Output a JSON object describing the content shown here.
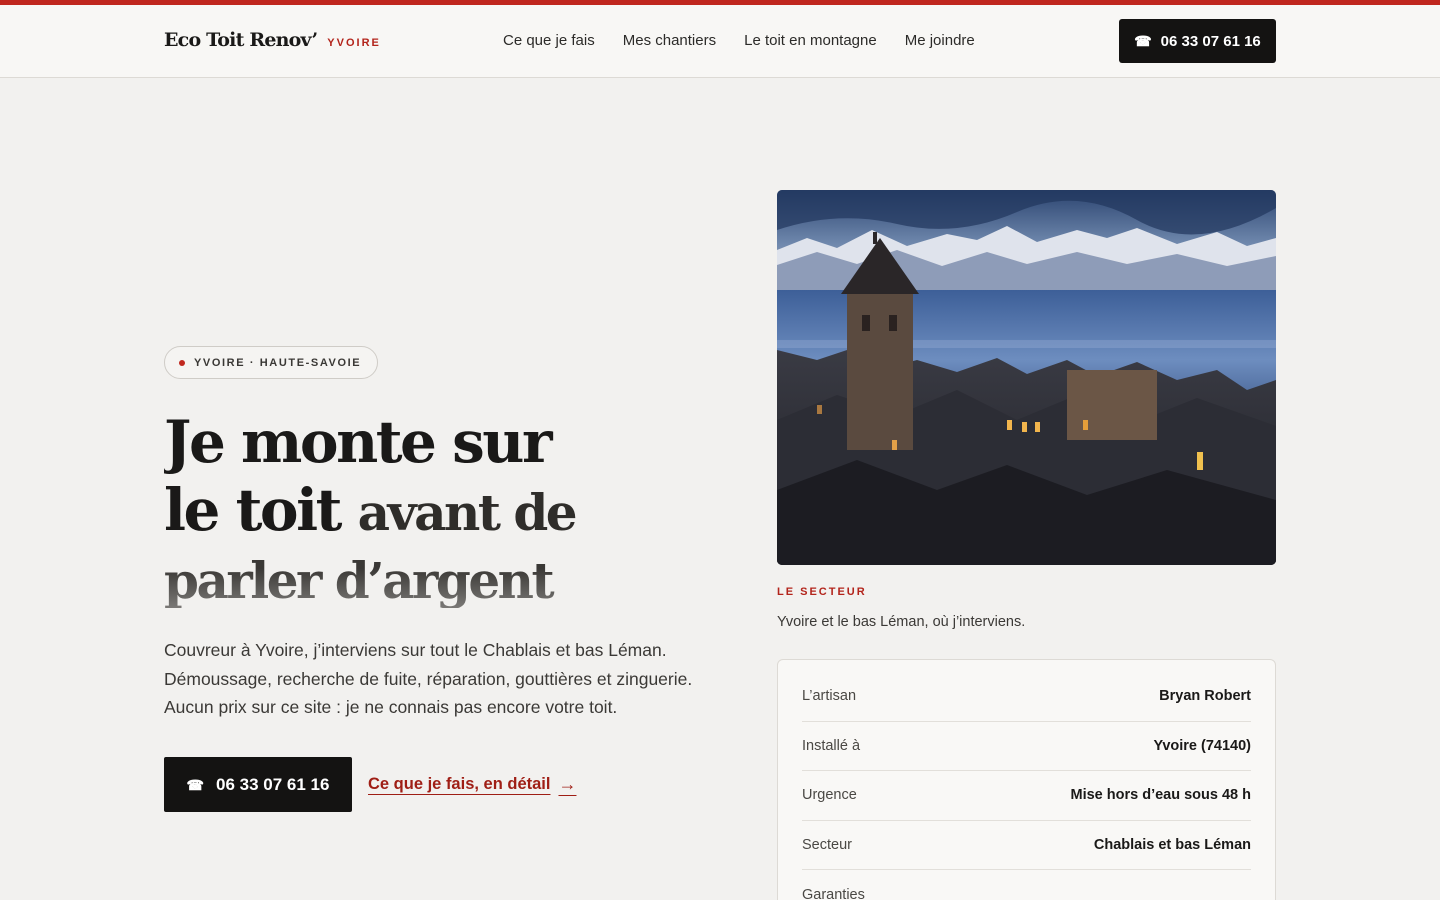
{
  "brand": {
    "name": "Eco Toit Renov’",
    "city": "YVOIRE",
    "accent": "#c0271e"
  },
  "nav": {
    "items": [
      {
        "label": "Ce que je fais"
      },
      {
        "label": "Mes chantiers"
      },
      {
        "label": "Le toit en montagne"
      },
      {
        "label": "Me joindre"
      }
    ],
    "cta_phone": "06 33 07 61 16",
    "cta_icon": "phone-icon"
  },
  "hero": {
    "badge": "YVOIRE · HAUTE-SAVOIE",
    "headline": {
      "line1": "Je monte sur",
      "line2_a": "le toit ",
      "line2_b": "avant de",
      "line3": "parler d’argent"
    },
    "intro": [
      "Couvreur à Yvoire, j’interviens sur tout le Chablais et bas Léman.",
      "Démoussage, recherche de fuite, réparation, gouttières et zinguerie.",
      "Aucun prix sur ce site : je ne connais pas encore votre toit."
    ],
    "cta_phone": "06 33 07 61 16",
    "cta_link": "Ce que je fais, en détail",
    "cta_arrow": "→"
  },
  "sector": {
    "kicker": "LE SECTEUR",
    "caption": "Yvoire et le bas Léman, où j’interviens."
  },
  "info": {
    "rows": [
      {
        "label": "L’artisan",
        "value": "Bryan Robert"
      },
      {
        "label": "Installé à",
        "value": "Yvoire (74140)"
      },
      {
        "label": "Urgence",
        "value": "Mise hors d’eau sous 48 h"
      },
      {
        "label": "Secteur",
        "value": "Chablais et bas Léman"
      },
      {
        "label": "Garanties",
        "value": ""
      }
    ]
  }
}
